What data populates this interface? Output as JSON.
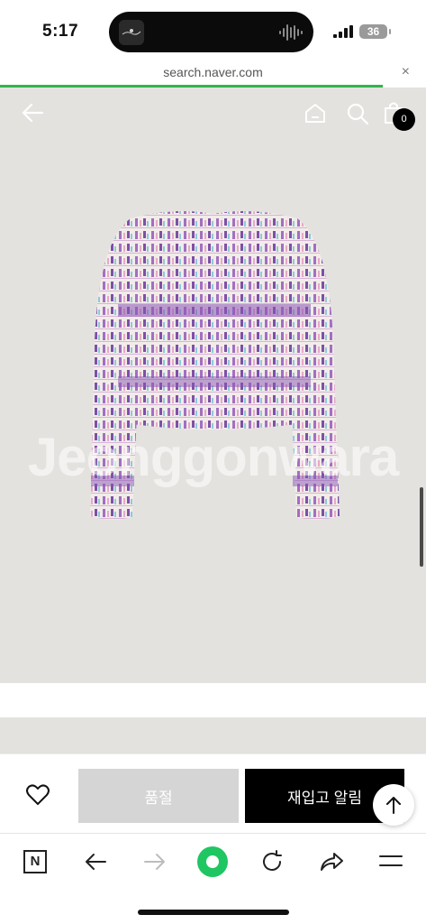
{
  "status_bar": {
    "time": "5:17",
    "battery": "36"
  },
  "url_bar": {
    "url": "search.naver.com",
    "close_glyph": "×"
  },
  "product_view": {
    "watermark": "Jeonggonwara",
    "cart_count": "0",
    "icons": [
      "back-arrow-icon",
      "home-icon",
      "search-icon",
      "shopping-bag-icon"
    ]
  },
  "purchase_bar": {
    "sold_out_label": "품절",
    "restock_alert_label": "재입고 알림",
    "colors": {
      "sold_out_bg": "#d5d5d5",
      "restock_bg": "#000000"
    }
  },
  "toolbar": {
    "n_label": "N",
    "accent": "#1fc662",
    "icons": [
      "naver-n-icon",
      "back-icon",
      "forward-icon",
      "green-dot-icon",
      "refresh-icon",
      "share-icon",
      "menu-icon"
    ]
  }
}
